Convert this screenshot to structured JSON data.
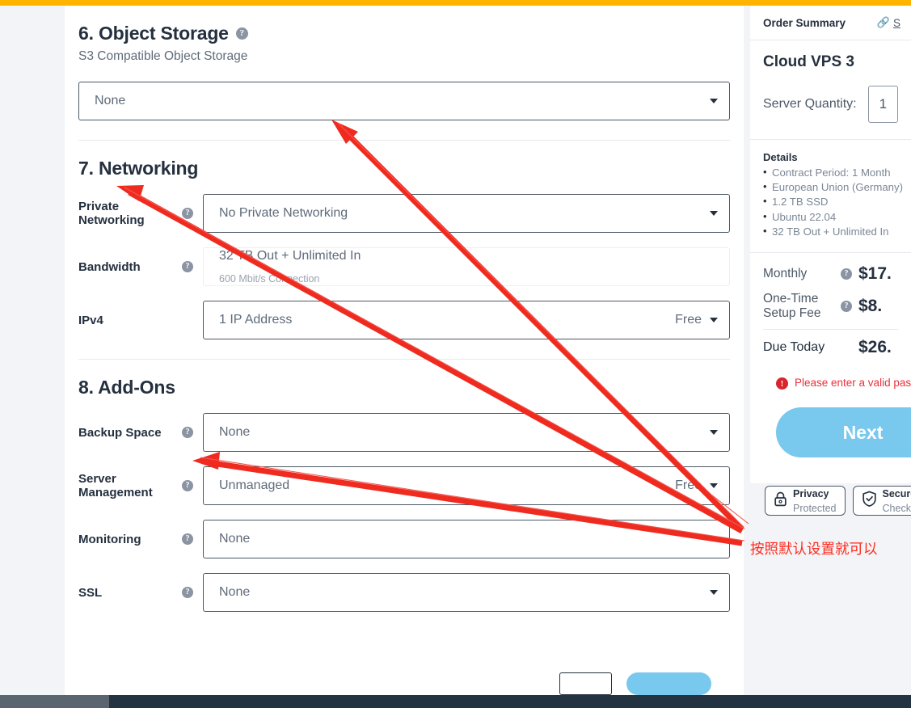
{
  "brand": {
    "accent_color": "#ffb400"
  },
  "sections": [
    {
      "number_title": "6. Object Storage",
      "subtitle": "S3 Compatible Object Storage",
      "field_value": "None"
    },
    {
      "number_title": "7. Networking",
      "rows": [
        {
          "label": "Private Networking",
          "value": "No Private Networking",
          "sub": "",
          "right": ""
        },
        {
          "label": "Bandwidth",
          "value": "32 TB Out + Unlimited In",
          "sub": "600 Mbit/s Connection",
          "right": ""
        },
        {
          "label": "IPv4",
          "value": "1 IP Address",
          "sub": "",
          "right": "Free"
        }
      ]
    },
    {
      "number_title": "8. Add-Ons",
      "rows": [
        {
          "label": "Backup Space",
          "value": "None",
          "sub": "",
          "right": ""
        },
        {
          "label": "Server Management",
          "value": "Unmanaged",
          "sub": "",
          "right": "Free"
        },
        {
          "label": "Monitoring",
          "value": "None",
          "sub": "",
          "right": ""
        },
        {
          "label": "SSL",
          "value": "None",
          "sub": "",
          "right": ""
        }
      ]
    }
  ],
  "summary": {
    "header_title": "Order Summary",
    "share_label": "S",
    "product_name": "Cloud VPS 3",
    "quantity_label": "Server Quantity:",
    "quantity_value": "1",
    "details_title": "Details",
    "details": [
      "Contract Period: 1 Month",
      "European Union (Germany)",
      "1.2 TB SSD",
      "Ubuntu 22.04",
      "32 TB Out + Unlimited In"
    ],
    "monthly_label": "Monthly",
    "monthly_value": "$17.",
    "setup_label": "One-Time Setup Fee",
    "setup_value": "$8.",
    "due_label": "Due Today",
    "due_value": "$26.",
    "error_text": "Please enter a valid passwo",
    "next_label": "Next",
    "badges": [
      {
        "title": "Privacy",
        "subtitle": "Protected",
        "icon": "lock-icon"
      },
      {
        "title": "Secure",
        "subtitle": "Checko",
        "icon": "shield-check-icon"
      }
    ]
  },
  "annotation": {
    "note_text": "按照默认设置就可以",
    "color": "#ff2a1f"
  },
  "help_glyph": "?"
}
